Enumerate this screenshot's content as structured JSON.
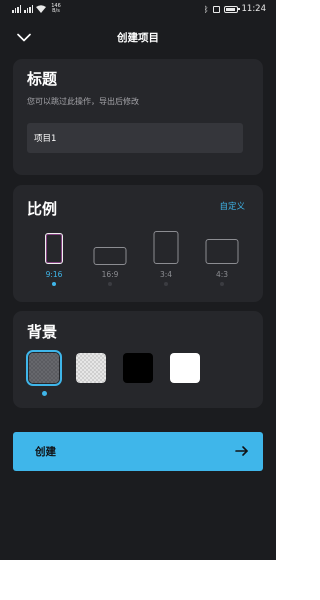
{
  "status_bar": {
    "network_speed_value": "146",
    "network_speed_unit": "B/s",
    "time": "11:24",
    "icons": [
      "signal-icon",
      "signal-icon",
      "wifi-icon",
      "bluetooth-icon",
      "vibrate-icon",
      "battery-icon"
    ]
  },
  "header": {
    "title": "创建项目",
    "back_icon": "chevron-down-icon"
  },
  "title_section": {
    "heading": "标题",
    "hint": "您可以跳过此操作，导出后修改",
    "input_value": "项目1"
  },
  "ratio_section": {
    "heading": "比例",
    "custom_label": "自定义",
    "selected_index": 0,
    "options": [
      {
        "label": "9:16"
      },
      {
        "label": "16:9"
      },
      {
        "label": "3:4"
      },
      {
        "label": "4:3"
      }
    ]
  },
  "background_section": {
    "heading": "背景",
    "selected_index": 0,
    "swatches": [
      {
        "name": "transparent-dark",
        "color": "#5b5c61"
      },
      {
        "name": "transparent-light",
        "color": "#e6e6e6"
      },
      {
        "name": "black",
        "color": "#000000"
      },
      {
        "name": "white",
        "color": "#ffffff"
      }
    ]
  },
  "create_button": {
    "label": "创建",
    "icon": "arrow-right-icon"
  },
  "colors": {
    "accent": "#3fb6ea",
    "background": "#1b1c1f",
    "card": "#26272b",
    "input": "#35363b"
  }
}
